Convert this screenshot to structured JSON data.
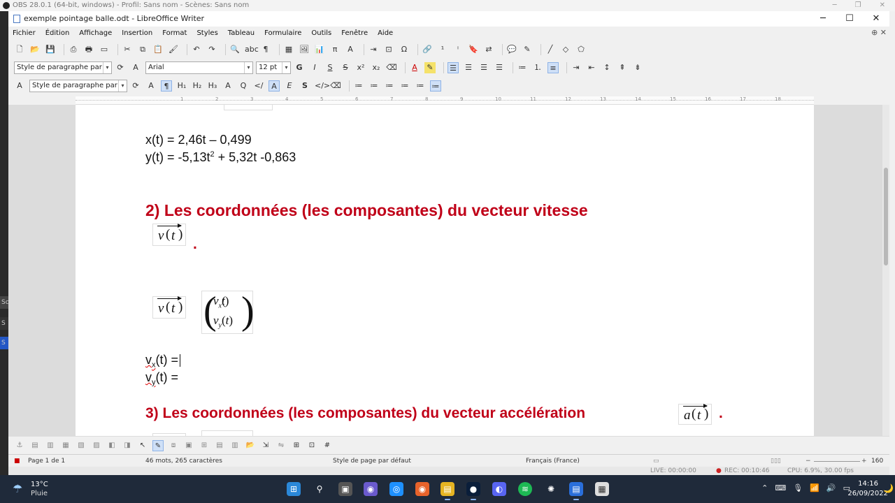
{
  "obs": {
    "title": "OBS 28.0.1 (64-bit, windows) - Profil: Sans nom - Scènes: Sans nom",
    "live": "LIVE: 00:00:00",
    "rec": "REC: 00:10:46",
    "cpu": "CPU: 6.9%, 30.00 fps"
  },
  "window": {
    "title": "exemple pointage balle.odt - LibreOffice Writer",
    "min": "─",
    "max": "☐",
    "close": "✕"
  },
  "menu": [
    "Fichier",
    "Édition",
    "Affichage",
    "Insertion",
    "Format",
    "Styles",
    "Tableau",
    "Formulaire",
    "Outils",
    "Fenêtre",
    "Aide"
  ],
  "format_bar": {
    "paragraph_style": "Style de paragraphe par déf",
    "font_name": "Arial",
    "font_size": "12 pt",
    "bold": "G",
    "italic": "I",
    "underline": "S",
    "strike": "S",
    "superscript": "x²",
    "subscript": "x₂"
  },
  "sidebar_bar": {
    "paragraph_style": "Style de paragraphe par déf",
    "h1": "H₁",
    "h2": "H₂",
    "h3": "H₃"
  },
  "ruler_numbers": [
    "1",
    "2",
    "3",
    "4",
    "5",
    "6",
    "7",
    "8",
    "9",
    "10",
    "11",
    "12",
    "13",
    "14",
    "15",
    "16",
    "17",
    "18"
  ],
  "document": {
    "eq_x": "x(t) = 2,46t – 0,499",
    "eq_y_pre": "y(t) = -5,13t",
    "eq_y_sup": "2",
    "eq_y_post": " + 5,32t -0,863",
    "heading2": "2) Les coordonnées (les composantes) du vecteur vitesse",
    "v_symbol": "v",
    "t_symbol": "t",
    "dot": ".",
    "vx_sub": "x",
    "vy_sub": "y",
    "vx_line_pre": "v",
    "vx_line_sub": "x",
    "vx_line_post": "(t) =",
    "vy_line_pre": "v",
    "vy_line_sub": "y",
    "vy_line_post": "(t) =",
    "heading3": "3) Les coordonnées (les composantes) du vecteur accélération",
    "a_symbol": "a"
  },
  "status": {
    "page": "Page 1 de 1",
    "words": "46 mots, 265 caractères",
    "page_style": "Style de page par défaut",
    "language": "Français (France)",
    "zoom": "160 %"
  },
  "taskbar": {
    "temp": "13°C",
    "condition": "Pluie",
    "time": "14:16",
    "date": "26/09/2022"
  },
  "colors": {
    "heading": "#c00018",
    "taskbar": "#1f2a3a",
    "accent": "#4a78c2"
  }
}
